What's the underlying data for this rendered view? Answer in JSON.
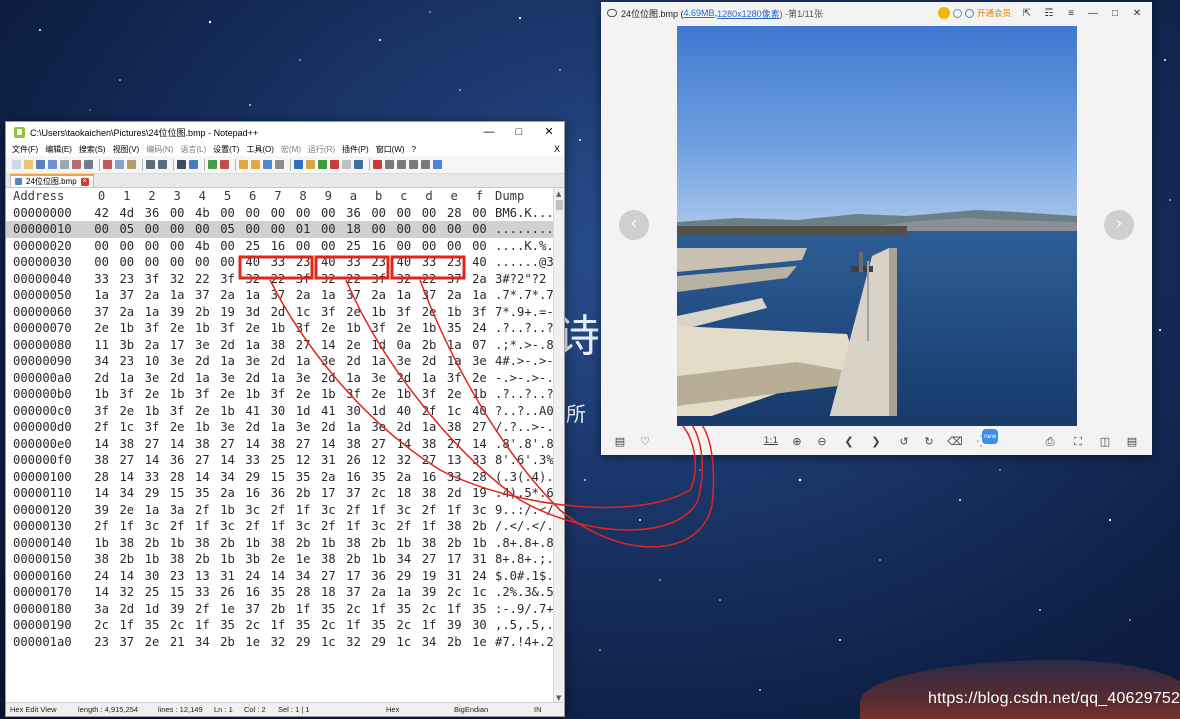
{
  "colors": {
    "desktop": "#173264",
    "annotation_red": "#e1251b",
    "npp_tab_accent": "#f7a23e",
    "viewer_link": "#2b68c9",
    "vip_orange": "#e67e00"
  },
  "desktop": {
    "char_big": "诗",
    "char_small": "所",
    "watermark": "https://blog.csdn.net/qq_40629752"
  },
  "notepad": {
    "title": "C:\\Users\\taokaichen\\Pictures\\24位位图.bmp - Notepad++",
    "menu": [
      "文件(F)",
      "编辑(E)",
      "搜索(S)",
      "视图(V)",
      "编码(N)",
      "语言(L)",
      "设置(T)",
      "工具(O)",
      "宏(M)",
      "运行(R)",
      "插件(P)",
      "窗口(W)",
      "?"
    ],
    "menu_close": "X",
    "tab_label": "24位位图.bmp",
    "hex": {
      "header": {
        "address": "Address",
        "cols": [
          "0",
          "1",
          "2",
          "3",
          "4",
          "5",
          "6",
          "7",
          "8",
          "9",
          "a",
          "b",
          "c",
          "d",
          "e",
          "f"
        ],
        "dump": "Dump"
      },
      "rows": [
        {
          "addr": "00000000",
          "bytes": [
            "42",
            "4d",
            "36",
            "00",
            "4b",
            "00",
            "00",
            "00",
            "00",
            "00",
            "36",
            "00",
            "00",
            "00",
            "28",
            "00"
          ],
          "dump": "BM6.K..."
        },
        {
          "addr": "00000010",
          "bytes": [
            "00",
            "05",
            "00",
            "00",
            "00",
            "05",
            "00",
            "00",
            "01",
            "00",
            "18",
            "00",
            "00",
            "00",
            "00",
            "00"
          ],
          "dump": "........"
        },
        {
          "addr": "00000020",
          "bytes": [
            "00",
            "00",
            "00",
            "00",
            "4b",
            "00",
            "25",
            "16",
            "00",
            "00",
            "25",
            "16",
            "00",
            "00",
            "00",
            "00"
          ],
          "dump": "....K.%."
        },
        {
          "addr": "00000030",
          "bytes": [
            "00",
            "00",
            "00",
            "00",
            "00",
            "00",
            "40",
            "33",
            "23",
            "40",
            "33",
            "23",
            "40",
            "33",
            "23",
            "40"
          ],
          "dump": "......@3"
        },
        {
          "addr": "00000040",
          "bytes": [
            "33",
            "23",
            "3f",
            "32",
            "22",
            "3f",
            "32",
            "22",
            "3f",
            "32",
            "22",
            "3f",
            "32",
            "22",
            "37",
            "2a"
          ],
          "dump": "3#?2\"?2"
        },
        {
          "addr": "00000050",
          "bytes": [
            "1a",
            "37",
            "2a",
            "1a",
            "37",
            "2a",
            "1a",
            "37",
            "2a",
            "1a",
            "37",
            "2a",
            "1a",
            "37",
            "2a",
            "1a"
          ],
          "dump": ".7*.7*.7"
        },
        {
          "addr": "00000060",
          "bytes": [
            "37",
            "2a",
            "1a",
            "39",
            "2b",
            "19",
            "3d",
            "2d",
            "1c",
            "3f",
            "2e",
            "1b",
            "3f",
            "2e",
            "1b",
            "3f"
          ],
          "dump": "7*.9+.=-"
        },
        {
          "addr": "00000070",
          "bytes": [
            "2e",
            "1b",
            "3f",
            "2e",
            "1b",
            "3f",
            "2e",
            "1b",
            "3f",
            "2e",
            "1b",
            "3f",
            "2e",
            "1b",
            "35",
            "24"
          ],
          "dump": ".?..?..?"
        },
        {
          "addr": "00000080",
          "bytes": [
            "11",
            "3b",
            "2a",
            "17",
            "3e",
            "2d",
            "1a",
            "38",
            "27",
            "14",
            "2e",
            "1d",
            "0a",
            "2b",
            "1a",
            "07"
          ],
          "dump": ".;*.>-.8"
        },
        {
          "addr": "00000090",
          "bytes": [
            "34",
            "23",
            "10",
            "3e",
            "2d",
            "1a",
            "3e",
            "2d",
            "1a",
            "3e",
            "2d",
            "1a",
            "3e",
            "2d",
            "1a",
            "3e"
          ],
          "dump": "4#.>-.>-"
        },
        {
          "addr": "000000a0",
          "bytes": [
            "2d",
            "1a",
            "3e",
            "2d",
            "1a",
            "3e",
            "2d",
            "1a",
            "3e",
            "2d",
            "1a",
            "3e",
            "2d",
            "1a",
            "3f",
            "2e"
          ],
          "dump": "-.>-.>-."
        },
        {
          "addr": "000000b0",
          "bytes": [
            "1b",
            "3f",
            "2e",
            "1b",
            "3f",
            "2e",
            "1b",
            "3f",
            "2e",
            "1b",
            "3f",
            "2e",
            "1b",
            "3f",
            "2e",
            "1b"
          ],
          "dump": ".?..?..?"
        },
        {
          "addr": "000000c0",
          "bytes": [
            "3f",
            "2e",
            "1b",
            "3f",
            "2e",
            "1b",
            "41",
            "30",
            "1d",
            "41",
            "30",
            "1d",
            "40",
            "2f",
            "1c",
            "40"
          ],
          "dump": "?..?..A0"
        },
        {
          "addr": "000000d0",
          "bytes": [
            "2f",
            "1c",
            "3f",
            "2e",
            "1b",
            "3e",
            "2d",
            "1a",
            "3e",
            "2d",
            "1a",
            "3e",
            "2d",
            "1a",
            "38",
            "27"
          ],
          "dump": "/.?..>-."
        },
        {
          "addr": "000000e0",
          "bytes": [
            "14",
            "38",
            "27",
            "14",
            "38",
            "27",
            "14",
            "38",
            "27",
            "14",
            "38",
            "27",
            "14",
            "38",
            "27",
            "14"
          ],
          "dump": ".8'.8'.8"
        },
        {
          "addr": "000000f0",
          "bytes": [
            "38",
            "27",
            "14",
            "36",
            "27",
            "14",
            "33",
            "25",
            "12",
            "31",
            "26",
            "12",
            "32",
            "27",
            "13",
            "33"
          ],
          "dump": "8'.6'.3%"
        },
        {
          "addr": "00000100",
          "bytes": [
            "28",
            "14",
            "33",
            "28",
            "14",
            "34",
            "29",
            "15",
            "35",
            "2a",
            "16",
            "35",
            "2a",
            "16",
            "33",
            "28"
          ],
          "dump": "(.3(.4)."
        },
        {
          "addr": "00000110",
          "bytes": [
            "14",
            "34",
            "29",
            "15",
            "35",
            "2a",
            "16",
            "36",
            "2b",
            "17",
            "37",
            "2c",
            "18",
            "38",
            "2d",
            "19"
          ],
          "dump": ".4).5*.6"
        },
        {
          "addr": "00000120",
          "bytes": [
            "39",
            "2e",
            "1a",
            "3a",
            "2f",
            "1b",
            "3c",
            "2f",
            "1f",
            "3c",
            "2f",
            "1f",
            "3c",
            "2f",
            "1f",
            "3c"
          ],
          "dump": "9..:/.</"
        },
        {
          "addr": "00000130",
          "bytes": [
            "2f",
            "1f",
            "3c",
            "2f",
            "1f",
            "3c",
            "2f",
            "1f",
            "3c",
            "2f",
            "1f",
            "3c",
            "2f",
            "1f",
            "38",
            "2b"
          ],
          "dump": "/.</.</."
        },
        {
          "addr": "00000140",
          "bytes": [
            "1b",
            "38",
            "2b",
            "1b",
            "38",
            "2b",
            "1b",
            "38",
            "2b",
            "1b",
            "38",
            "2b",
            "1b",
            "38",
            "2b",
            "1b"
          ],
          "dump": ".8+.8+.8"
        },
        {
          "addr": "00000150",
          "bytes": [
            "38",
            "2b",
            "1b",
            "38",
            "2b",
            "1b",
            "3b",
            "2e",
            "1e",
            "38",
            "2b",
            "1b",
            "34",
            "27",
            "17",
            "31"
          ],
          "dump": "8+.8+.;."
        },
        {
          "addr": "00000160",
          "bytes": [
            "24",
            "14",
            "30",
            "23",
            "13",
            "31",
            "24",
            "14",
            "34",
            "27",
            "17",
            "36",
            "29",
            "19",
            "31",
            "24"
          ],
          "dump": "$.0#.1$."
        },
        {
          "addr": "00000170",
          "bytes": [
            "14",
            "32",
            "25",
            "15",
            "33",
            "26",
            "16",
            "35",
            "28",
            "18",
            "37",
            "2a",
            "1a",
            "39",
            "2c",
            "1c"
          ],
          "dump": ".2%.3&.5"
        },
        {
          "addr": "00000180",
          "bytes": [
            "3a",
            "2d",
            "1d",
            "39",
            "2f",
            "1e",
            "37",
            "2b",
            "1f",
            "35",
            "2c",
            "1f",
            "35",
            "2c",
            "1f",
            "35"
          ],
          "dump": ":-.9/.7+"
        },
        {
          "addr": "00000190",
          "bytes": [
            "2c",
            "1f",
            "35",
            "2c",
            "1f",
            "35",
            "2c",
            "1f",
            "35",
            "2c",
            "1f",
            "35",
            "2c",
            "1f",
            "39",
            "30"
          ],
          "dump": ",.5,.5,."
        },
        {
          "addr": "000001a0",
          "bytes": [
            "23",
            "37",
            "2e",
            "21",
            "34",
            "2b",
            "1e",
            "32",
            "29",
            "1c",
            "32",
            "29",
            "1c",
            "34",
            "2b",
            "1e"
          ],
          "dump": "#7.!4+.2"
        }
      ]
    },
    "status": {
      "mode": "Hex Edit View",
      "length": "length : 4,915,254",
      "lines": "lines : 12,149",
      "ln": "Ln : 1",
      "col": "Col : 2",
      "sel": "Sel : 1 | 1",
      "encoding": "Hex",
      "endian": "BigEndian",
      "ins": "IN"
    }
  },
  "viewer": {
    "title_name": "24位位图.bmp (",
    "title_size": "4.69MB",
    "title_sep": ", ",
    "title_dims": "1280x1280像素",
    "title_rest": ") -第1/11张",
    "vip_label": "开通会员",
    "new_badge": "new",
    "ratio_label": "1:1"
  },
  "highlight": {
    "annotated_triplets": [
      [
        "40",
        "33",
        "23"
      ],
      [
        "40",
        "33",
        "23"
      ],
      [
        "40",
        "33",
        "23"
      ]
    ]
  }
}
